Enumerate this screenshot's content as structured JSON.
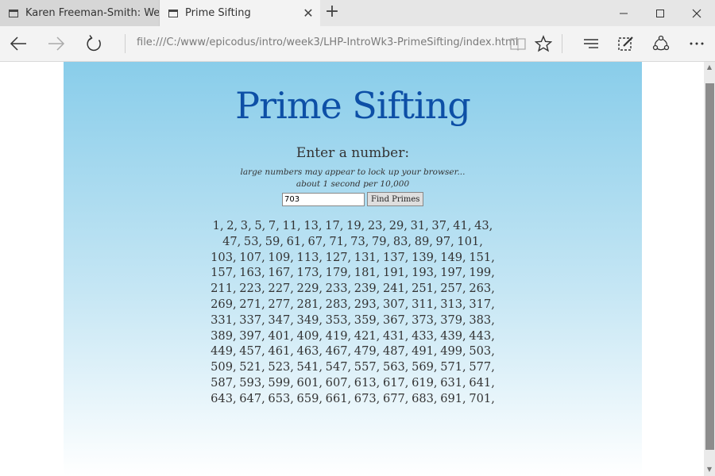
{
  "browser": {
    "tabs": [
      {
        "title": "Karen Freeman-Smith: Web",
        "active": false
      },
      {
        "title": "Prime Sifting",
        "active": true
      }
    ],
    "address": "file:///C:/www/epicodus/intro/week3/LHP-IntroWk3-PrimeSifting/index.html",
    "icons": {
      "back": "back-arrow-icon",
      "forward": "forward-arrow-icon",
      "refresh": "refresh-icon",
      "reading_view": "reading-view-icon",
      "favorite": "star-icon",
      "hub": "hub-icon",
      "notes": "web-note-icon",
      "share": "share-icon",
      "more": "more-icon"
    }
  },
  "page": {
    "heading": "Prime Sifting",
    "prompt": "Enter a number:",
    "note_line1": "large numbers may appear to lock up your browser...",
    "note_line2": "about 1 second per 10,000",
    "input_value": "703",
    "button_label": "Find Primes",
    "result": "1, 2, 3, 5, 7, 11, 13, 17, 19, 23, 29, 31, 37, 41, 43, 47, 53, 59, 61, 67, 71, 73, 79, 83, 89, 97, 101, 103, 107, 109, 113, 127, 131, 137, 139, 149, 151, 157, 163, 167, 173, 179, 181, 191, 193, 197, 199, 211, 223, 227, 229, 233, 239, 241, 251, 257, 263, 269, 271, 277, 281, 283, 293, 307, 311, 313, 317, 331, 337, 347, 349, 353, 359, 367, 373, 379, 383, 389, 397, 401, 409, 419, 421, 431, 433, 439, 443, 449, 457, 461, 463, 467, 479, 487, 491, 499, 503, 509, 521, 523, 541, 547, 557, 563, 569, 571, 577, 587, 593, 599, 601, 607, 613, 617, 619, 631, 641, 643, 647, 653, 659, 661, 673, 677, 683, 691, 701,"
  },
  "colors": {
    "heading": "#0d4fa6",
    "gradient_top": "#89cdea",
    "gradient_bottom": "#ffffff"
  }
}
